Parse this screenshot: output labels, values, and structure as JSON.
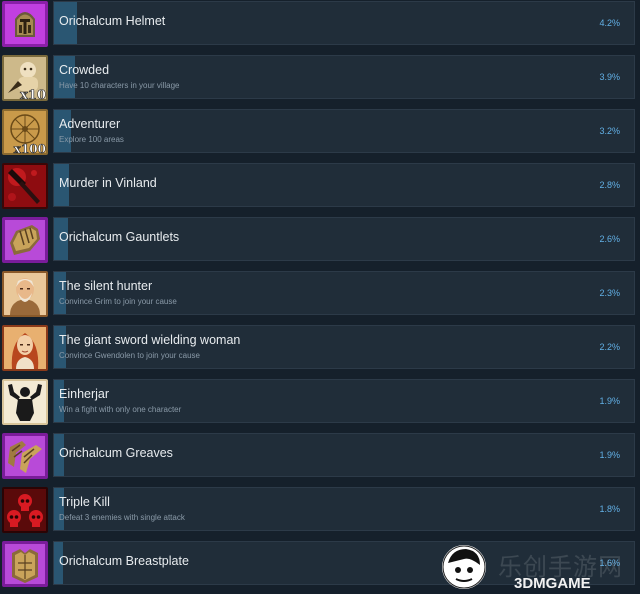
{
  "achievements": [
    {
      "title": "Orichalcum Helmet",
      "desc": "",
      "pct": "4.2%",
      "pct_value": 4.2,
      "icon": "helmet-icon"
    },
    {
      "title": "Crowded",
      "desc": "Have 10 characters in your village",
      "pct": "3.9%",
      "pct_value": 3.9,
      "icon": "crowd-x10-icon",
      "badge": "x10"
    },
    {
      "title": "Adventurer",
      "desc": "Explore 100 areas",
      "pct": "3.2%",
      "pct_value": 3.2,
      "icon": "map-x100-icon",
      "badge": "x100"
    },
    {
      "title": "Murder in Vinland",
      "desc": "",
      "pct": "2.8%",
      "pct_value": 2.8,
      "icon": "bloody-hammer-icon"
    },
    {
      "title": "Orichalcum Gauntlets",
      "desc": "",
      "pct": "2.6%",
      "pct_value": 2.6,
      "icon": "gauntlets-icon"
    },
    {
      "title": "The silent hunter",
      "desc": "Convince Grim to join your cause",
      "pct": "2.3%",
      "pct_value": 2.3,
      "icon": "hunter-portrait-icon"
    },
    {
      "title": "The giant sword wielding woman",
      "desc": "Convince Gwendolen to join your cause",
      "pct": "2.2%",
      "pct_value": 2.2,
      "icon": "woman-portrait-icon"
    },
    {
      "title": "Einherjar",
      "desc": "Win a fight with only one character",
      "pct": "1.9%",
      "pct_value": 1.9,
      "icon": "strongman-icon"
    },
    {
      "title": "Orichalcum Greaves",
      "desc": "",
      "pct": "1.9%",
      "pct_value": 1.9,
      "icon": "greaves-icon"
    },
    {
      "title": "Triple Kill",
      "desc": "Defeat 3 enemies with single attack",
      "pct": "1.8%",
      "pct_value": 1.8,
      "icon": "skulls-icon"
    },
    {
      "title": "Orichalcum Breastplate",
      "desc": "",
      "pct": "1.6%",
      "pct_value": 1.6,
      "icon": "breastplate-icon"
    }
  ],
  "colors": {
    "progress_bar": "#2a5672",
    "percent_text": "#62b0e6",
    "panel": "#202d39",
    "background": "#15202b"
  },
  "watermark": {
    "chinese": "乐创手游网",
    "logo": "3DMGAME"
  }
}
